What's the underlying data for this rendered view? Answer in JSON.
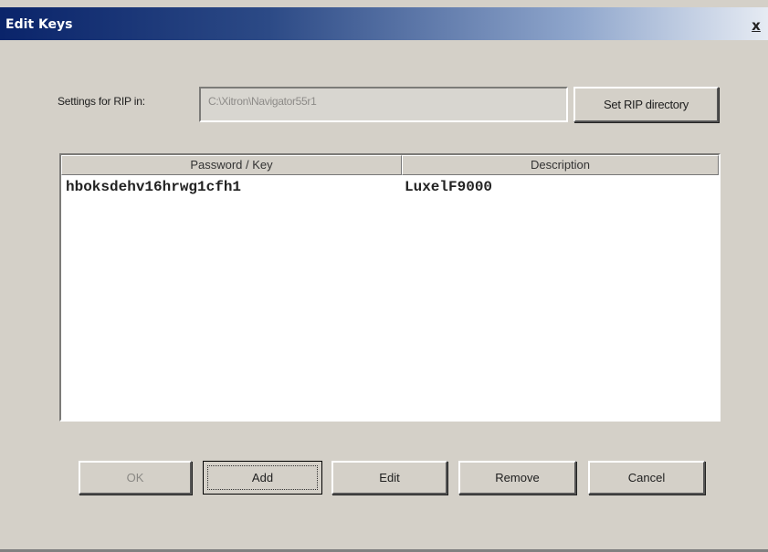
{
  "window": {
    "title": "Edit Keys",
    "close_label": "x"
  },
  "settings": {
    "label": "Settings for RIP in:",
    "path": "C:\\Xitron\\Navigator55r1",
    "set_dir_button": "Set RIP directory"
  },
  "table": {
    "columns": [
      "Password / Key",
      "Description"
    ],
    "rows": [
      {
        "key": "hboksdehv16hrwg1cfh1",
        "description": "LuxelF9000"
      }
    ]
  },
  "buttons": {
    "ok": "OK",
    "add": "Add",
    "edit": "Edit",
    "remove": "Remove",
    "cancel": "Cancel"
  },
  "colors": {
    "title_bar_start": "#0a246a",
    "dialog_face": "#d4d0c8"
  }
}
